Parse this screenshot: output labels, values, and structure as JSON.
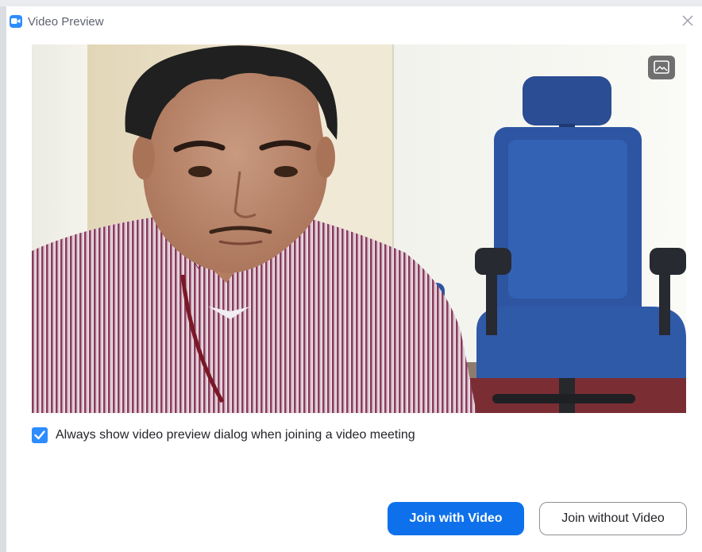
{
  "window": {
    "title": "Video Preview",
    "app_icon": "zoom-camera-icon",
    "close_icon": "close-icon"
  },
  "video": {
    "background_icon": "virtual-background-icon"
  },
  "options": {
    "preview_checkbox_label": "Always show video preview dialog when joining a video meeting",
    "preview_checkbox_checked": true
  },
  "actions": {
    "join_with_video": "Join with Video",
    "join_without_video": "Join without Video"
  },
  "colors": {
    "accent": "#0e71eb",
    "brand": "#2d8cff"
  }
}
